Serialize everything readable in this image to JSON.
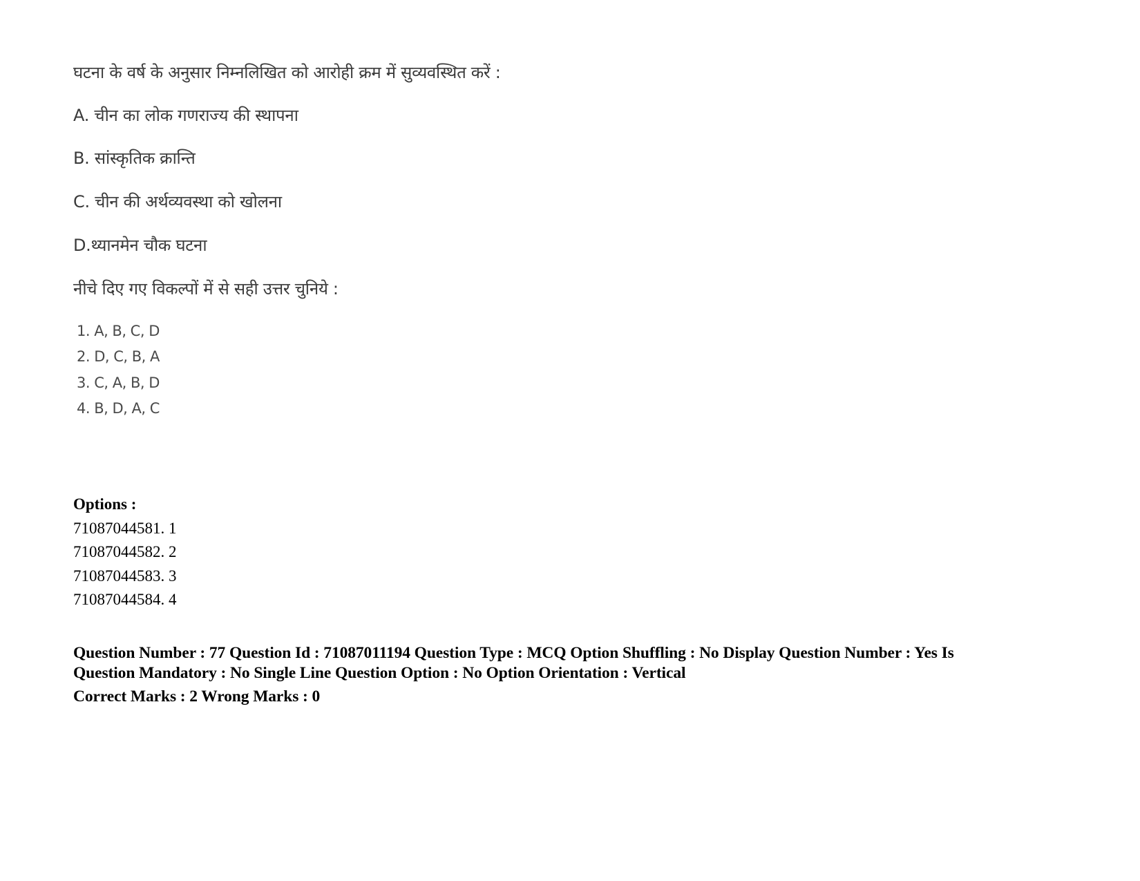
{
  "question": {
    "prompt": "घटना के वर्ष के अनुसार निम्नलिखित को आरोही क्रम में सुव्यवस्थित करें :",
    "statements": [
      "A. चीन का लोक गणराज्य की स्थापना",
      "B. सांस्कृतिक क्रान्ति",
      "C. चीन की अर्थव्यवस्था को खोलना",
      "D.थ्यानमेन चौक घटना"
    ],
    "instruction": "नीचे दिए गए विकल्पों में से सही उत्तर चुनिये :",
    "choices": [
      "1. A, B, C, D",
      "2. D, C, B, A",
      "3. C, A, B, D",
      "4. B, D, A, C"
    ]
  },
  "options": {
    "heading": "Options :",
    "items": [
      "71087044581. 1",
      "71087044582. 2",
      "71087044583. 3",
      "71087044584. 4"
    ]
  },
  "metadata": {
    "line1": "Question Number : 77 Question Id : 71087011194 Question Type : MCQ Option Shuffling : No Display Question Number : Yes Is",
    "line2": "Question Mandatory : No Single Line Question Option : No Option Orientation : Vertical",
    "marks": "Correct Marks : 2 Wrong Marks : 0"
  }
}
